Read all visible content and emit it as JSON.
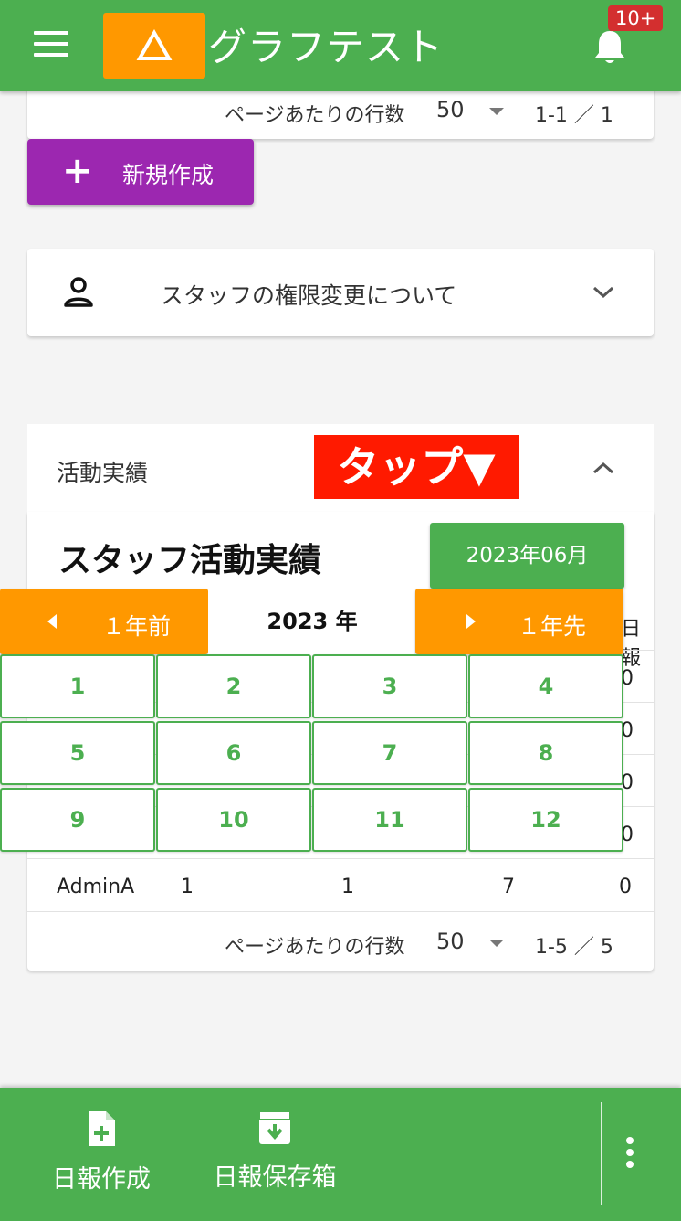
{
  "appbar": {
    "title": "グラフテスト",
    "badge": "10+",
    "menu_icon": "menu-icon",
    "logo_icon": "warning-triangle-icon",
    "bell_icon": "bell-icon"
  },
  "top_pager": {
    "rows_label": "ページあたりの行数",
    "rows_value": "50",
    "range": "1-1 ／ 1"
  },
  "new_button": {
    "label": "新規作成"
  },
  "staff_permissions": {
    "title": "スタッフの権限変更について"
  },
  "activity": {
    "header": "活動実績",
    "tap_overlay": "タップ▼",
    "card_title": "スタッフ活動実績",
    "date_button": "2023年06月",
    "header_fragment": "日報",
    "row_fragments": [
      "0",
      "0",
      "0",
      "0"
    ],
    "last_row": {
      "name": "AdminA",
      "c1": "1",
      "c2": "1",
      "c3": "7",
      "c4": "0"
    },
    "pager": {
      "rows_label": "ページあたりの行数",
      "rows_value": "50",
      "range": "1-5 ／ 5"
    }
  },
  "month_picker": {
    "prev_label": "１年前",
    "next_label": "１年先",
    "year_label": "2023 年",
    "months": [
      "1",
      "2",
      "3",
      "4",
      "5",
      "6",
      "7",
      "8",
      "9",
      "10",
      "11",
      "12"
    ]
  },
  "bottom_nav": {
    "create_label": "日報作成",
    "archive_label": "日報保存箱"
  },
  "colors": {
    "primary": "#4caf50",
    "accent": "#ff9800",
    "purple": "#9c27b0",
    "tap_red": "#ff1a00",
    "badge_red": "#d32f2f"
  }
}
